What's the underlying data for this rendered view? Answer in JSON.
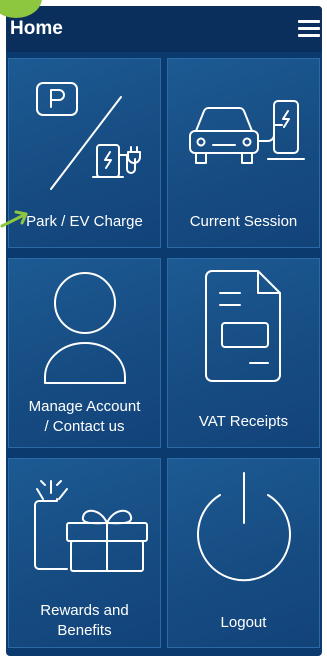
{
  "header": {
    "title": "Home",
    "menu_icon": "hamburger-menu-icon"
  },
  "tiles": [
    {
      "label": "Park / EV Charge",
      "icon": "parking-ev-charge-icon"
    },
    {
      "label": "Current Session",
      "icon": "car-charging-icon"
    },
    {
      "label": "Manage Account / Contact us",
      "label_line1": "Manage Account",
      "label_line2": "/ Contact us",
      "icon": "user-account-icon"
    },
    {
      "label": "VAT Receipts",
      "icon": "document-receipt-icon"
    },
    {
      "label": "Rewards and Benefits",
      "label_line1": "Rewards and",
      "label_line2": "Benefits",
      "icon": "gift-icon"
    },
    {
      "label": "Logout",
      "icon": "power-icon"
    }
  ],
  "colors": {
    "background": "#0b3a6e",
    "header": "#0a2f5c",
    "tile": "#1a5590",
    "icon_stroke": "#ffffff",
    "accent": "#8dc63f"
  }
}
